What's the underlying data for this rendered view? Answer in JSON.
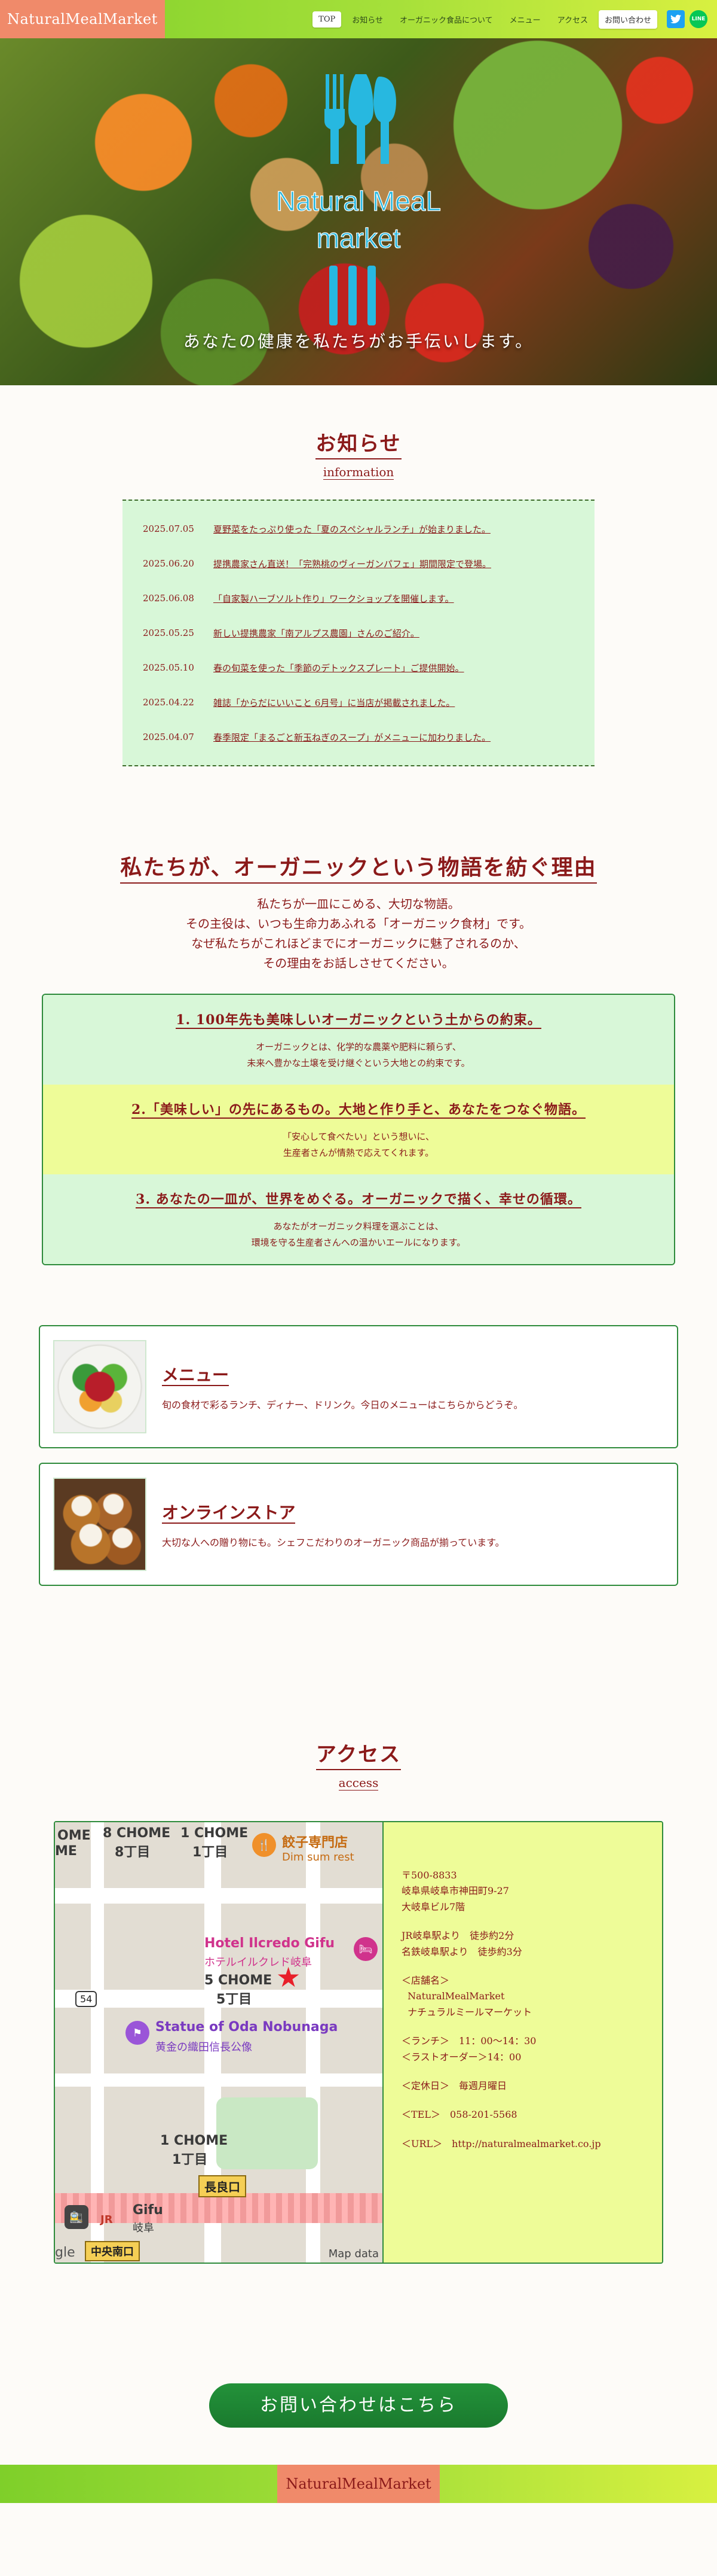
{
  "header": {
    "logo": "NaturalMealMarket",
    "nav": [
      {
        "label": "TOP"
      },
      {
        "label": "お知らせ"
      },
      {
        "label": "オーガニック食品について"
      },
      {
        "label": "メニュー"
      },
      {
        "label": "アクセス"
      }
    ],
    "contact": "お問い合わせ",
    "social": {
      "twitter_icon": "twitter-icon",
      "line_icon": "line-icon",
      "line_text": "LINE"
    }
  },
  "hero": {
    "logo_line1": "Natural MeaL",
    "logo_line2": "market",
    "tagline": "あなたの健康を私たちがお手伝いします。"
  },
  "info": {
    "title": "お知らせ",
    "subtitle": "information",
    "news": [
      {
        "date": "2025.07.05",
        "text": "夏野菜をたっぷり使った「夏のスペシャルランチ」が始まりました。"
      },
      {
        "date": "2025.06.20",
        "text": "提携農家さん直送！「完熟桃のヴィーガンパフェ」期間限定で登場。"
      },
      {
        "date": "2025.06.08",
        "text": "「自家製ハーブソルト作り」ワークショップを開催します。"
      },
      {
        "date": "2025.05.25",
        "text": "新しい提携農家「南アルプス農園」さんのご紹介。"
      },
      {
        "date": "2025.05.10",
        "text": "春の旬菜を使った「季節のデトックスプレート」ご提供開始。"
      },
      {
        "date": "2025.04.22",
        "text": "雑誌「からだにいいこと 6月号」に当店が掲載されました。"
      },
      {
        "date": "2025.04.07",
        "text": "春季限定「まるごと新玉ねぎのスープ」がメニューに加わりました。"
      }
    ]
  },
  "reason": {
    "title": "私たちが、オーガニックという物語を紡ぐ理由",
    "lead": [
      "私たちが一皿にこめる、大切な物語。",
      "その主役は、いつも生命力あふれる「オーガニック食材」です。",
      "なぜ私たちがこれほどまでにオーガニックに魅了されるのか、",
      "その理由をお話しさせてください。"
    ],
    "items": [
      {
        "head": "1. 100年先も美味しいオーガニックという土からの約束。",
        "body": [
          "オーガニックとは、化学的な農薬や肥料に頼らず、",
          "未来へ豊かな土壌を受け継ぐという大地との約束です。"
        ]
      },
      {
        "head": "2.「美味しい」の先にあるもの。大地と作り手と、あなたをつなぐ物語。",
        "body": [
          "「安心して食べたい」という想いに、",
          "生産者さんが情熱で応えてくれます。"
        ]
      },
      {
        "head": "3. あなたの一皿が、世界をめぐる。オーガニックで描く、幸せの循環。",
        "body": [
          "あなたがオーガニック料理を選ぶことは、",
          "環境を守る生産者さんへの温かいエールになります。"
        ]
      }
    ]
  },
  "cards": [
    {
      "title": "メニュー",
      "text": "旬の食材で彩るランチ、ディナー、ドリンク。今日のメニューはこちらからどうぞ。"
    },
    {
      "title": "オンラインストア",
      "text": "大切な人への贈り物にも。シェフこだわりのオーガニック商品が揃っています。"
    }
  ],
  "access": {
    "title": "アクセス",
    "subtitle": "access",
    "map": {
      "labels": {
        "chome8": "8 CHOME",
        "chome8jp": "8丁目",
        "chome1a": "1 CHOME",
        "chome1ajp": "1丁目",
        "gyoza": "餃子専門店",
        "dimsum": "Dim sum rest",
        "hotel": "Hotel Ilcredo Gifu",
        "hoteljp": "ホテルイルクレド岐阜",
        "chome5": "5 CHOME",
        "chome5jp": "5丁目",
        "statue": "Statue of Oda Nobunaga",
        "statuejp": "黄金の織田信長公像",
        "chome1b": "1 CHOME",
        "chome1bjp": "1丁目",
        "nagara": "長良口",
        "gifu": "Gifu",
        "gifujp": "岐阜",
        "chuo": "中央南口",
        "route": "54",
        "ome": "OME",
        "me": "ME",
        "google": "gle",
        "mapdata": "Map data",
        "jr": "JR"
      }
    },
    "address": {
      "zip": "〒500-8833",
      "line1": "岐阜県岐阜市神田町9-27",
      "line2": "大岐阜ビル7階",
      "jr": "JR岐阜駅より　徒歩約2分",
      "meitetsu": "名鉄岐阜駅より　徒歩約3分",
      "shop_label": "＜店舗名＞",
      "shop_en": "NaturalMealMarket",
      "shop_jp": "ナチュラルミールマーケット",
      "lunch": "＜ランチ＞　11：00〜14：30",
      "lastorder": "＜ラストオーダー＞14：00",
      "holiday": "＜定休日＞　毎週月曜日",
      "tel": "＜TEL＞　058-201-5568",
      "url": "＜URL＞　http://naturalmealmarket.co.jp"
    }
  },
  "cta": "お問い合わせはこちら",
  "footer": {
    "logo": "NaturalMealMarket"
  }
}
